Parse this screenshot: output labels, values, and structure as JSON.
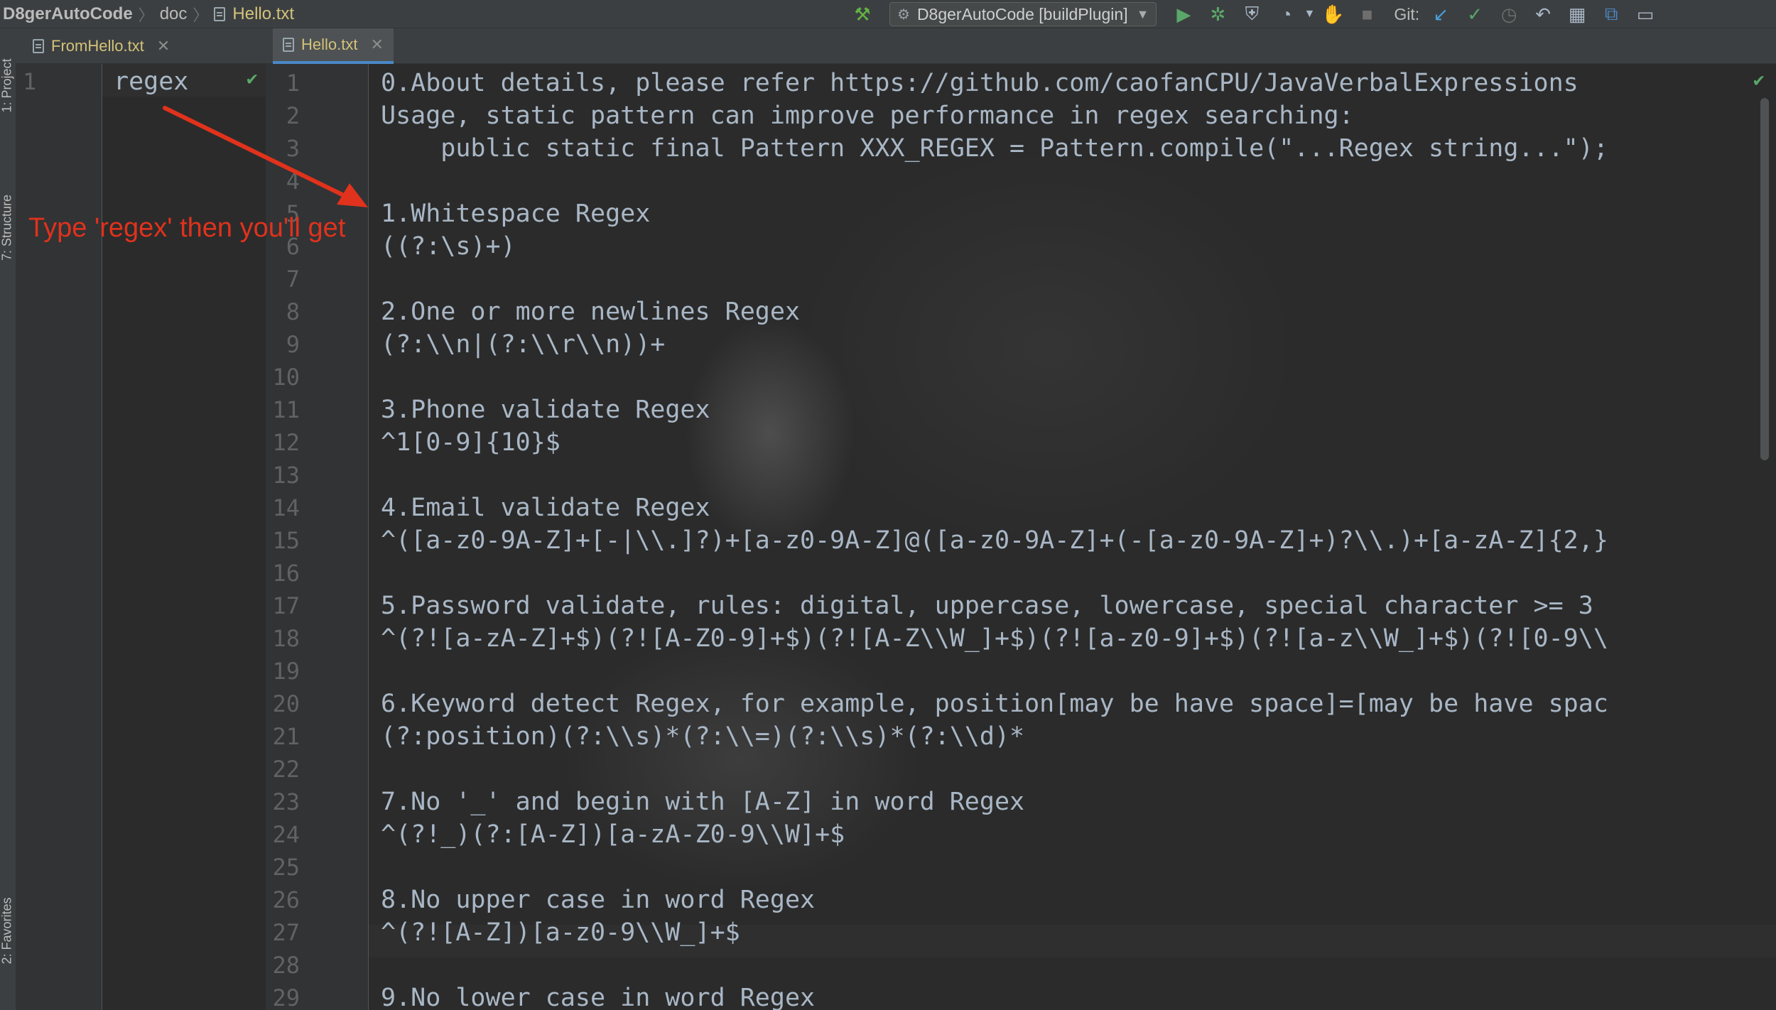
{
  "breadcrumb": {
    "project": "D8gerAutoCode",
    "folder": "doc",
    "file": "Hello.txt"
  },
  "toolbar": {
    "run_config": "D8gerAutoCode [buildPlugin]",
    "git_label": "Git:",
    "icons": [
      "hammer-icon",
      "run-icon",
      "debug-icon",
      "coverage-icon",
      "profile-icon",
      "attach-icon",
      "stop-icon",
      "git-update-icon",
      "git-commit-icon",
      "history-icon",
      "revert-icon",
      "project-structure-icon",
      "translate-icon",
      "layout-icon"
    ]
  },
  "side_tools": {
    "project": "1: Project",
    "structure": "7: Structure",
    "favorites": "2: Favorites"
  },
  "tabs": {
    "left": "FromHello.txt",
    "right": "Hello.txt"
  },
  "left_editor": {
    "line_numbers": [
      "1"
    ],
    "lines": [
      "regex"
    ]
  },
  "right_editor": {
    "line_numbers": [
      "1",
      "2",
      "3",
      "4",
      "5",
      "6",
      "7",
      "8",
      "9",
      "10",
      "11",
      "12",
      "13",
      "14",
      "15",
      "16",
      "17",
      "18",
      "19",
      "20",
      "21",
      "22",
      "23",
      "24",
      "25",
      "26",
      "27",
      "28",
      "29"
    ],
    "lines": [
      "0.About details, please refer https://github.com/caofanCPU/JavaVerbalExpressions",
      "Usage, static pattern can improve performance in regex searching:",
      "    public static final Pattern XXX_REGEX = Pattern.compile(\"...Regex string...\");",
      "",
      "1.Whitespace Regex",
      "((?:\\s)+)",
      "",
      "2.One or more newlines Regex",
      "(?:\\\\n|(?:\\\\r\\\\n))+",
      "",
      "3.Phone validate Regex",
      "^1[0-9]{10}$",
      "",
      "4.Email validate Regex",
      "^([a-z0-9A-Z]+[-|\\\\.]?)+[a-z0-9A-Z]@([a-z0-9A-Z]+(-[a-z0-9A-Z]+)?\\\\.)+[a-zA-Z]{2,}",
      "",
      "5.Password validate, rules: digital, uppercase, lowercase, special character >= 3",
      "^(?![a-zA-Z]+$)(?![A-Z0-9]+$)(?![A-Z\\\\W_]+$)(?![a-z0-9]+$)(?![a-z\\\\W_]+$)(?![0-9\\\\",
      "",
      "6.Keyword detect Regex, for example, position[may be have space]=[may be have spac",
      "(?:position)(?:\\\\s)*(?:\\\\=)(?:\\\\s)*(?:\\\\d)*",
      "",
      "7.No '_' and begin with [A-Z] in word Regex",
      "^(?!_)(?:[A-Z])[a-zA-Z0-9\\\\W]+$",
      "",
      "8.No upper case in word Regex",
      "^(?![A-Z])[a-z0-9\\\\W_]+$",
      "",
      "9.No lower case in word Regex"
    ]
  },
  "annotation": "Type 'regex' then you'll get",
  "colors": {
    "annotation": "#e0321c",
    "code_text": "#a9b7c6",
    "line_number": "#606366",
    "tab_text": "#d3c27a",
    "check": "#59a869"
  }
}
